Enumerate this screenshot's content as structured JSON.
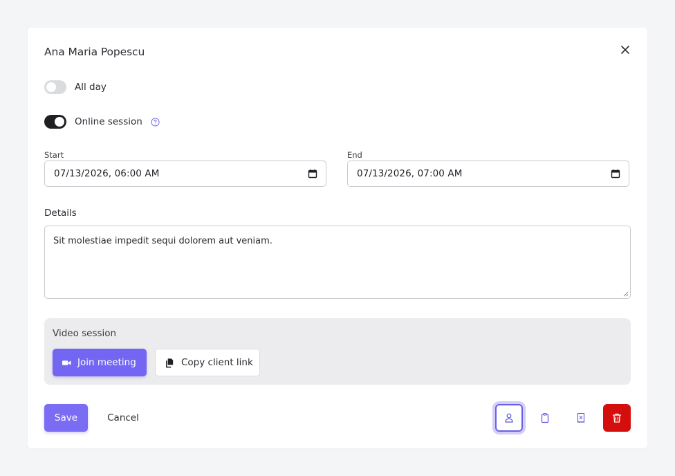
{
  "dialog": {
    "title": "Ana Maria Popescu",
    "toggles": {
      "all_day": {
        "label": "All day",
        "state": "off"
      },
      "online_session": {
        "label": "Online session",
        "state": "on"
      }
    },
    "start": {
      "label": "Start",
      "value": "07/13/2026, 06:00 AM"
    },
    "end": {
      "label": "End",
      "value": "07/13/2026, 07:00 AM"
    },
    "details": {
      "label": "Details",
      "value": "Sit molestiae impedit sequi dolorem aut veniam."
    },
    "video_session": {
      "title": "Video session",
      "join_label": "Join meeting",
      "copy_label": "Copy client link"
    },
    "footer": {
      "save_label": "Save",
      "cancel_label": "Cancel",
      "icon_buttons": [
        "person-icon",
        "clipboard-icon",
        "invoice-icon",
        "trash-icon"
      ]
    }
  },
  "colors": {
    "accent": "#7366f2",
    "danger": "#d40d0d",
    "toggle_on": "#1f1f24",
    "background": "#f4f5f7"
  }
}
